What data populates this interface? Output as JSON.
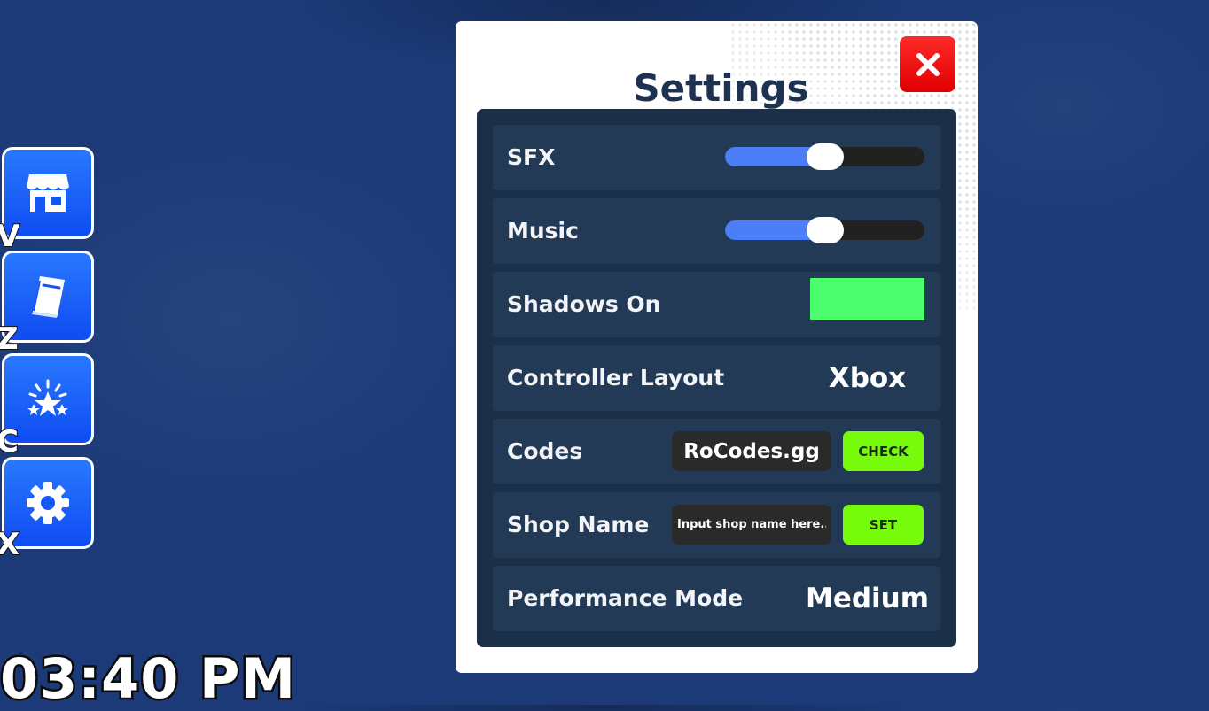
{
  "window": {
    "title": "Settings",
    "close_icon": "close-x-icon"
  },
  "settings": {
    "sfx": {
      "label": "SFX",
      "value": 0.5
    },
    "music": {
      "label": "Music",
      "value": 0.5
    },
    "shadows": {
      "label": "Shadows On",
      "state": "on",
      "color": "#4cfd6d"
    },
    "controller": {
      "label": "Controller Layout",
      "value": "Xbox"
    },
    "codes": {
      "label": "Codes",
      "value": "RoCodes.gg",
      "button": "CHECK"
    },
    "shop_name": {
      "label": "Shop Name",
      "placeholder": "Input shop name here...",
      "button": "SET"
    },
    "performance": {
      "label": "Performance Mode",
      "value": "Medium"
    }
  },
  "side_menu": [
    {
      "icon": "shop-icon",
      "hotkey": "V"
    },
    {
      "icon": "book-icon",
      "hotkey": "Z"
    },
    {
      "icon": "stars-icon",
      "hotkey": "C"
    },
    {
      "icon": "gear-icon",
      "hotkey": "X"
    }
  ],
  "clock": "03:40 PM",
  "colors": {
    "accent_blue": "#0f4cf2",
    "slider_fill": "#4b7ef7",
    "button_green": "#76fc0a",
    "close_red": "#e00000",
    "panel_bg": "#1b2f48"
  }
}
